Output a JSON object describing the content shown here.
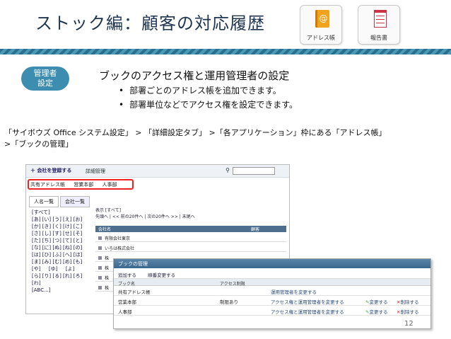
{
  "header": {
    "title": "ストック編：顧客の対応履歴",
    "icons": [
      {
        "label": "アドレス帳",
        "icon": "address-book-icon",
        "color": "#f2a31e"
      },
      {
        "label": "報告書",
        "icon": "report-icon",
        "color": "#cc3344"
      }
    ]
  },
  "badge": {
    "line1": "管理者",
    "line2": "設定"
  },
  "subtitle": "ブックのアクセス権と運用管理者の設定",
  "bullets": [
    "部署ごとのアドレス帳を追加できます。",
    "部署単位などでアクセス権を設定できます。"
  ],
  "path_line1": "「サイボウズ Office システム設定」 > 「詳細設定タブ」 >「各アプリケーション」枠にある「アドレス帳」",
  "path_line2": ">「ブックの管理」",
  "shot1": {
    "add_label": "＋ 会社を登録する",
    "manage_label": "詳細管理",
    "books": [
      "共有アドレス帳",
      "営業本部",
      "人事部"
    ],
    "tabs": [
      "人名一覧",
      "会社一覧"
    ],
    "index_all": "[すべて]",
    "index": [
      "[あ] [い] [う] [え] [お]",
      "[か] [き] [く] [け] [こ]",
      "[さ] [し] [す] [せ] [そ]",
      "[た] [ち] [つ] [て] [と]",
      "[な] [に] [ぬ] [ね] [の]",
      "[は] [ひ] [ふ] [へ] [ほ]",
      "[ま] [み] [む] [め] [も]",
      "[や] 　 [ゆ] 　 [よ]",
      "[ら] [り] [る] [れ] [ろ]",
      "[わ]",
      "[ABC...]"
    ],
    "display": "表示 [すべて]",
    "pager": "先頭へ | << 前の20件へ | 次の20件へ >> | 末尾へ",
    "col_name": "会社名",
    "col_access": "顧客",
    "rows": [
      "有限会社東京",
      "いろは株式会社",
      "株",
      "株",
      "株",
      "株"
    ]
  },
  "shot2": {
    "title": "ブックの管理",
    "add": "追加する",
    "order": "順番変更する",
    "col_book": "ブック名",
    "col_access": "アクセス制限",
    "rows": [
      {
        "name": "共有アドレス帳",
        "access": "",
        "action": "運用管理者を変更する",
        "edit": "",
        "del": ""
      },
      {
        "name": "営業本部",
        "access": "制限あり",
        "action": "アクセス権と運用管理者を変更する",
        "edit": "変更する",
        "del": "削除する"
      },
      {
        "name": "人事部",
        "access": "",
        "action": "アクセス権と運用管理者を変更する",
        "edit": "変更する",
        "del": "削除する"
      }
    ]
  },
  "page_number": "12"
}
